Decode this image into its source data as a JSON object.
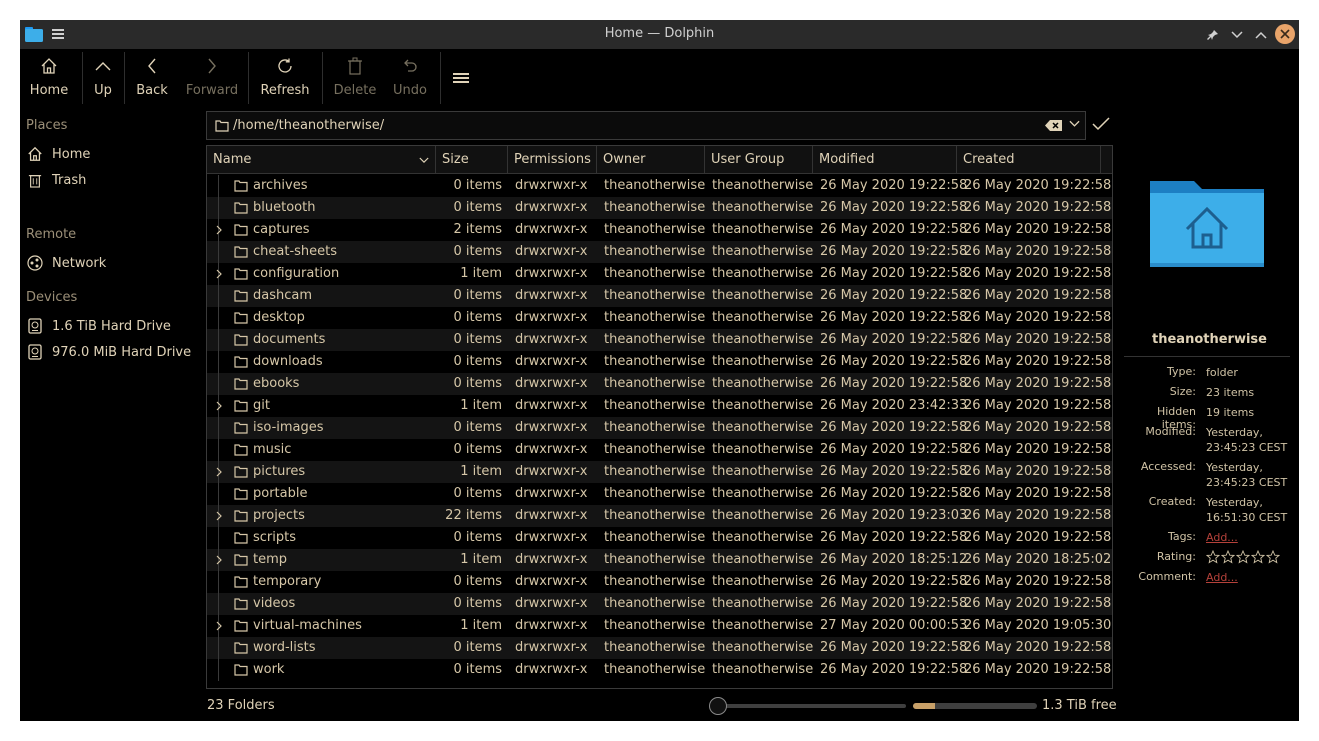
{
  "window": {
    "title": "Home — Dolphin"
  },
  "toolbar": {
    "items": [
      {
        "label": "Home",
        "icon": "home-icon",
        "enabled": true
      },
      {
        "label": "Up",
        "icon": "up-arrow-icon",
        "enabled": true
      },
      {
        "label": "Back",
        "icon": "back-arrow-icon",
        "enabled": true
      },
      {
        "label": "Forward",
        "icon": "forward-arrow-icon",
        "enabled": false
      },
      {
        "label": "Refresh",
        "icon": "refresh-icon",
        "enabled": true
      },
      {
        "label": "Delete",
        "icon": "trash-icon",
        "enabled": false
      },
      {
        "label": "Undo",
        "icon": "undo-icon",
        "enabled": false
      }
    ]
  },
  "sidebar": {
    "sections": [
      {
        "title": "Places",
        "items": [
          {
            "label": "Home",
            "icon": "home-icon"
          },
          {
            "label": "Trash",
            "icon": "trash-icon"
          }
        ]
      },
      {
        "title": "Remote",
        "items": [
          {
            "label": "Network",
            "icon": "network-icon"
          }
        ]
      },
      {
        "title": "Devices",
        "items": [
          {
            "label": "1.6 TiB Hard Drive",
            "icon": "hard-drive-icon"
          },
          {
            "label": "976.0 MiB Hard Drive",
            "icon": "hard-drive-icon"
          }
        ]
      }
    ]
  },
  "location": {
    "path": "/home/theanotherwise/"
  },
  "columns": [
    "Name",
    "Size",
    "Permissions",
    "Owner",
    "User Group",
    "Modified",
    "Created"
  ],
  "files": [
    {
      "name": "archives",
      "size": "0 items",
      "perm": "drwxrwxr-x",
      "owner": "theanotherwise",
      "group": "theanotherwise",
      "modified": "26 May 2020 19:22:58",
      "created": "26 May 2020 19:22:58",
      "expandable": false
    },
    {
      "name": "bluetooth",
      "size": "0 items",
      "perm": "drwxrwxr-x",
      "owner": "theanotherwise",
      "group": "theanotherwise",
      "modified": "26 May 2020 19:22:58",
      "created": "26 May 2020 19:22:58",
      "expandable": false
    },
    {
      "name": "captures",
      "size": "2 items",
      "perm": "drwxrwxr-x",
      "owner": "theanotherwise",
      "group": "theanotherwise",
      "modified": "26 May 2020 19:22:58",
      "created": "26 May 2020 19:22:58",
      "expandable": true
    },
    {
      "name": "cheat-sheets",
      "size": "0 items",
      "perm": "drwxrwxr-x",
      "owner": "theanotherwise",
      "group": "theanotherwise",
      "modified": "26 May 2020 19:22:58",
      "created": "26 May 2020 19:22:58",
      "expandable": false
    },
    {
      "name": "configuration",
      "size": "1 item",
      "perm": "drwxrwxr-x",
      "owner": "theanotherwise",
      "group": "theanotherwise",
      "modified": "26 May 2020 19:22:58",
      "created": "26 May 2020 19:22:58",
      "expandable": true
    },
    {
      "name": "dashcam",
      "size": "0 items",
      "perm": "drwxrwxr-x",
      "owner": "theanotherwise",
      "group": "theanotherwise",
      "modified": "26 May 2020 19:22:58",
      "created": "26 May 2020 19:22:58",
      "expandable": false
    },
    {
      "name": "desktop",
      "size": "0 items",
      "perm": "drwxrwxr-x",
      "owner": "theanotherwise",
      "group": "theanotherwise",
      "modified": "26 May 2020 19:22:58",
      "created": "26 May 2020 19:22:58",
      "expandable": false
    },
    {
      "name": "documents",
      "size": "0 items",
      "perm": "drwxrwxr-x",
      "owner": "theanotherwise",
      "group": "theanotherwise",
      "modified": "26 May 2020 19:22:58",
      "created": "26 May 2020 19:22:58",
      "expandable": false
    },
    {
      "name": "downloads",
      "size": "0 items",
      "perm": "drwxrwxr-x",
      "owner": "theanotherwise",
      "group": "theanotherwise",
      "modified": "26 May 2020 19:22:58",
      "created": "26 May 2020 19:22:58",
      "expandable": false
    },
    {
      "name": "ebooks",
      "size": "0 items",
      "perm": "drwxrwxr-x",
      "owner": "theanotherwise",
      "group": "theanotherwise",
      "modified": "26 May 2020 19:22:58",
      "created": "26 May 2020 19:22:58",
      "expandable": false
    },
    {
      "name": "git",
      "size": "1 item",
      "perm": "drwxrwxr-x",
      "owner": "theanotherwise",
      "group": "theanotherwise",
      "modified": "26 May 2020 23:42:33",
      "created": "26 May 2020 19:22:58",
      "expandable": true
    },
    {
      "name": "iso-images",
      "size": "0 items",
      "perm": "drwxrwxr-x",
      "owner": "theanotherwise",
      "group": "theanotherwise",
      "modified": "26 May 2020 19:22:58",
      "created": "26 May 2020 19:22:58",
      "expandable": false
    },
    {
      "name": "music",
      "size": "0 items",
      "perm": "drwxrwxr-x",
      "owner": "theanotherwise",
      "group": "theanotherwise",
      "modified": "26 May 2020 19:22:58",
      "created": "26 May 2020 19:22:58",
      "expandable": false
    },
    {
      "name": "pictures",
      "size": "1 item",
      "perm": "drwxrwxr-x",
      "owner": "theanotherwise",
      "group": "theanotherwise",
      "modified": "26 May 2020 19:22:58",
      "created": "26 May 2020 19:22:58",
      "expandable": true
    },
    {
      "name": "portable",
      "size": "0 items",
      "perm": "drwxrwxr-x",
      "owner": "theanotherwise",
      "group": "theanotherwise",
      "modified": "26 May 2020 19:22:58",
      "created": "26 May 2020 19:22:58",
      "expandable": false
    },
    {
      "name": "projects",
      "size": "22 items",
      "perm": "drwxrwxr-x",
      "owner": "theanotherwise",
      "group": "theanotherwise",
      "modified": "26 May 2020 19:23:03",
      "created": "26 May 2020 19:22:58",
      "expandable": true
    },
    {
      "name": "scripts",
      "size": "0 items",
      "perm": "drwxrwxr-x",
      "owner": "theanotherwise",
      "group": "theanotherwise",
      "modified": "26 May 2020 19:22:58",
      "created": "26 May 2020 19:22:58",
      "expandable": false
    },
    {
      "name": "temp",
      "size": "1 item",
      "perm": "drwxrwxr-x",
      "owner": "theanotherwise",
      "group": "theanotherwise",
      "modified": "26 May 2020 18:25:12",
      "created": "26 May 2020 18:25:02",
      "expandable": true
    },
    {
      "name": "temporary",
      "size": "0 items",
      "perm": "drwxrwxr-x",
      "owner": "theanotherwise",
      "group": "theanotherwise",
      "modified": "26 May 2020 19:22:58",
      "created": "26 May 2020 19:22:58",
      "expandable": false
    },
    {
      "name": "videos",
      "size": "0 items",
      "perm": "drwxrwxr-x",
      "owner": "theanotherwise",
      "group": "theanotherwise",
      "modified": "26 May 2020 19:22:58",
      "created": "26 May 2020 19:22:58",
      "expandable": false
    },
    {
      "name": "virtual-machines",
      "size": "1 item",
      "perm": "drwxrwxr-x",
      "owner": "theanotherwise",
      "group": "theanotherwise",
      "modified": "27 May 2020 00:00:53",
      "created": "26 May 2020 19:05:30",
      "expandable": true
    },
    {
      "name": "word-lists",
      "size": "0 items",
      "perm": "drwxrwxr-x",
      "owner": "theanotherwise",
      "group": "theanotherwise",
      "modified": "26 May 2020 19:22:58",
      "created": "26 May 2020 19:22:58",
      "expandable": false
    },
    {
      "name": "work",
      "size": "0 items",
      "perm": "drwxrwxr-x",
      "owner": "theanotherwise",
      "group": "theanotherwise",
      "modified": "26 May 2020 19:22:58",
      "created": "26 May 2020 19:22:58",
      "expandable": false
    }
  ],
  "info": {
    "name": "theanotherwise",
    "type_label": "Type:",
    "type": "folder",
    "size_label": "Size:",
    "size": "23 items",
    "hidden_label": "Hidden items:",
    "hidden": "19 items",
    "modified_label": "Modified:",
    "modified": "Yesterday, 23:45:23 CEST",
    "accessed_label": "Accessed:",
    "accessed": "Yesterday, 23:45:23 CEST",
    "created_label": "Created:",
    "created": "Yesterday, 16:51:30 CEST",
    "tags_label": "Tags:",
    "tags": "Add...",
    "rating_label": "Rating:",
    "rating": 0,
    "comment_label": "Comment:",
    "comment": "Add..."
  },
  "status": {
    "count": "23 Folders",
    "free": "1.3 TiB free",
    "used_fraction": 0.18,
    "zoom_fraction": 0.0
  },
  "colors": {
    "accent": "#c8a068",
    "folder_blue": "#3daee9",
    "background": "#000000",
    "close": "#e9a46a"
  }
}
